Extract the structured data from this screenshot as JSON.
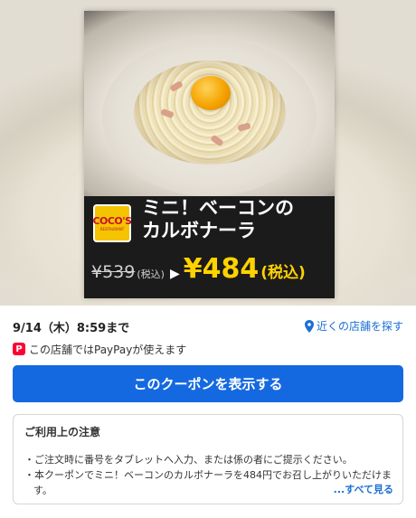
{
  "coupon": {
    "brand_logo_text": "COCO'S",
    "brand_logo_sub": "RESTAURANT",
    "title_line1": "ミニ！ベーコンの",
    "title_line2": "カルボナーラ",
    "old_price": "¥539",
    "old_price_tax": "(税込)",
    "arrow": "▶",
    "new_price": "¥484",
    "new_price_tax": "(税込)"
  },
  "info": {
    "deadline": "9/14（木）8:59まで",
    "nearby_link": "近くの店舗を探す",
    "paypay_badge": "P",
    "paypay_text": "この店舗ではPayPayが使えます"
  },
  "cta": {
    "label": "このクーポンを表示する"
  },
  "notes": {
    "title": "ご利用上の注意",
    "items": [
      "・ご注文時に番号をタブレットへ入力、または係の者にご提示ください。",
      "・本クーポンでミニ！ベーコンのカルボナーラを484円でお召し上がりいただけます。"
    ],
    "more_label": "...すべて見る"
  },
  "colors": {
    "accent_blue": "#1569e0",
    "price_yellow": "#ffd200",
    "paypay_red": "#ff0033",
    "logo_yellow": "#f4c400"
  }
}
